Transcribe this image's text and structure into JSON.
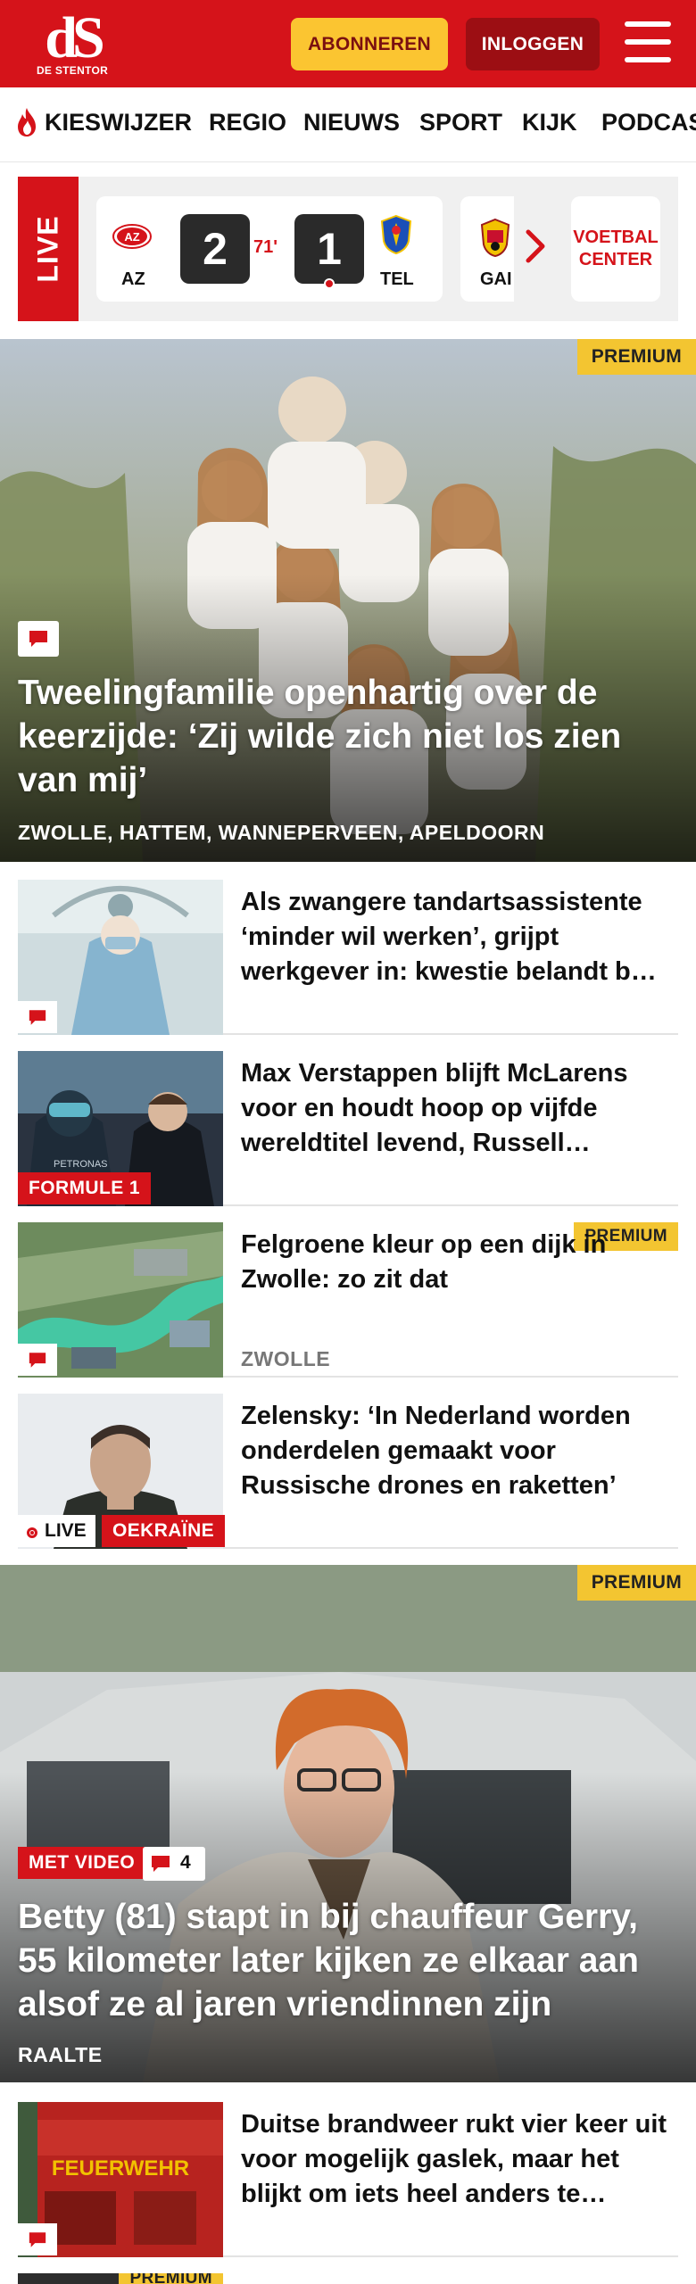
{
  "header": {
    "logo_text": "dS",
    "logo_subtitle": "DE STENTOR",
    "subscribe_label": "ABONNEREN",
    "login_label": "INLOGGEN",
    "brand_color": "#d5131a",
    "accent_color": "#fbc531"
  },
  "nav": {
    "items": [
      {
        "label": "KIESWIJZER",
        "icon": "flame-icon"
      },
      {
        "label": "REGIO"
      },
      {
        "label": "NIEUWS"
      },
      {
        "label": "SPORT"
      },
      {
        "label": "KIJK"
      },
      {
        "label": "PODCAS"
      }
    ]
  },
  "scores": {
    "live_label": "LIVE",
    "match": {
      "home_code": "AZ",
      "home_score": "2",
      "minute": "71'",
      "away_score": "1",
      "away_code": "TEL"
    },
    "next_match_code": "GAI",
    "voetbal_center_label": "VOETBAL CENTER"
  },
  "hero1": {
    "premium_label": "PREMIUM",
    "title": "Tweelingfamilie openhartig over de keerzijde: ‘Zij wilde zich niet los zien van mij’",
    "kicker": "ZWOLLE, HATTEM, WANNEPERVEEN, APELDOORN"
  },
  "articles": [
    {
      "title": "Als zwangere tandartsassistente ‘minder wil werken’, grijpt werkgever in: kwestie belandt b…",
      "tag": "",
      "kicker": ""
    },
    {
      "title": "Max Verstappen blijft McLarens voor en houdt hoop op vijfde wereldtitel levend, Russell…",
      "tag": "FORMULE 1",
      "kicker": ""
    },
    {
      "title": "Felgroene kleur op een dijk in Zwolle: zo zit dat",
      "tag": "PREMIUM",
      "kicker": "ZWOLLE"
    },
    {
      "title": "Zelensky: ‘In Nederland worden onderdelen gemaakt voor Russische drones en raketten’",
      "live_label": "LIVE",
      "tag": "OEKRAÏNE",
      "kicker": ""
    }
  ],
  "hero2": {
    "premium_label": "PREMIUM",
    "video_label": "MET VIDEO",
    "comment_count": "4",
    "title": "Betty (81) stapt in bij chauffeur Gerry, 55 kilometer later kijken ze elkaar aan alsof ze al jaren vriendinnen zijn",
    "kicker": "RAALTE"
  },
  "articles2": [
    {
      "title": "Duitse brandweer rukt vier keer uit voor mogelijk gaslek, maar het blijkt om iets heel anders te…",
      "tag": ""
    }
  ],
  "next_partial": {
    "premium_label": "PREMIUM"
  }
}
